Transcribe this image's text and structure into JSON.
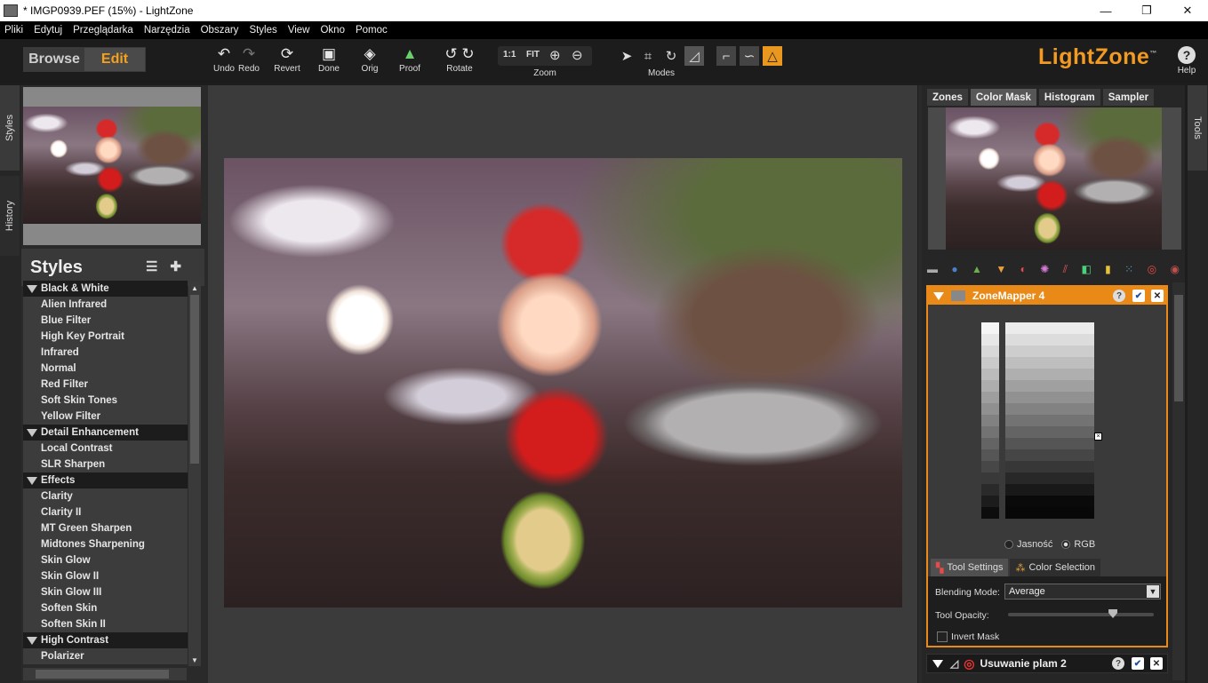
{
  "window": {
    "title": "* IMGP0939.PEF (15%) - LightZone",
    "minimize": "—",
    "maximize": "❐",
    "close": "✕"
  },
  "menu": [
    "Pliki",
    "Edytuj",
    "Przeglądarka",
    "Narzędzia",
    "Obszary",
    "Styles",
    "View",
    "Okno",
    "Pomoc"
  ],
  "toolbar": {
    "browse": "Browse",
    "edit": "Edit",
    "undo": "Undo",
    "redo": "Redo",
    "revert": "Revert",
    "done": "Done",
    "orig": "Orig",
    "proof": "Proof",
    "rotate": "Rotate",
    "zoom_one": "1:1",
    "zoom_fit": "FIT",
    "zoom": "Zoom",
    "modes": "Modes",
    "help": "Help",
    "logo": "LightZone",
    "tm": "™"
  },
  "left_tabs": {
    "styles": "Styles",
    "history": "History"
  },
  "styles": {
    "title": "Styles",
    "items": [
      {
        "label": "Black & White",
        "category": true
      },
      {
        "label": "Alien Infrared"
      },
      {
        "label": "Blue Filter"
      },
      {
        "label": "High Key Portrait"
      },
      {
        "label": "Infrared"
      },
      {
        "label": "Normal"
      },
      {
        "label": "Red Filter"
      },
      {
        "label": "Soft Skin Tones"
      },
      {
        "label": "Yellow Filter"
      },
      {
        "label": "Detail Enhancement",
        "category": true
      },
      {
        "label": "Local Contrast"
      },
      {
        "label": "SLR Sharpen"
      },
      {
        "label": "Effects",
        "category": true
      },
      {
        "label": "Clarity"
      },
      {
        "label": "Clarity II"
      },
      {
        "label": "MT Green Sharpen"
      },
      {
        "label": "Midtones Sharpening"
      },
      {
        "label": "Skin Glow"
      },
      {
        "label": "Skin Glow II"
      },
      {
        "label": "Skin Glow III"
      },
      {
        "label": "Soften Skin"
      },
      {
        "label": "Soften Skin II"
      },
      {
        "label": "High Contrast",
        "category": true
      },
      {
        "label": "Polarizer"
      }
    ]
  },
  "right_tabs": [
    "Zones",
    "Color Mask",
    "Histogram",
    "Sampler"
  ],
  "tools_tab": "Tools",
  "zonemapper": {
    "title": "ZoneMapper 4",
    "help": "?",
    "enable": "✔",
    "close": "✕",
    "radio_luminosity": "Jasność",
    "radio_rgb": "RGB",
    "subtab_settings": "Tool Settings",
    "subtab_color": "Color Selection",
    "blending_label": "Blending Mode:",
    "blending_value": "Average",
    "opacity_label": "Tool Opacity:",
    "opacity_value": 0.72,
    "invert_label": "Invert Mask"
  },
  "spot": {
    "title": "Usuwanie plam 2",
    "help": "?",
    "enable": "✔",
    "close": "✕"
  }
}
